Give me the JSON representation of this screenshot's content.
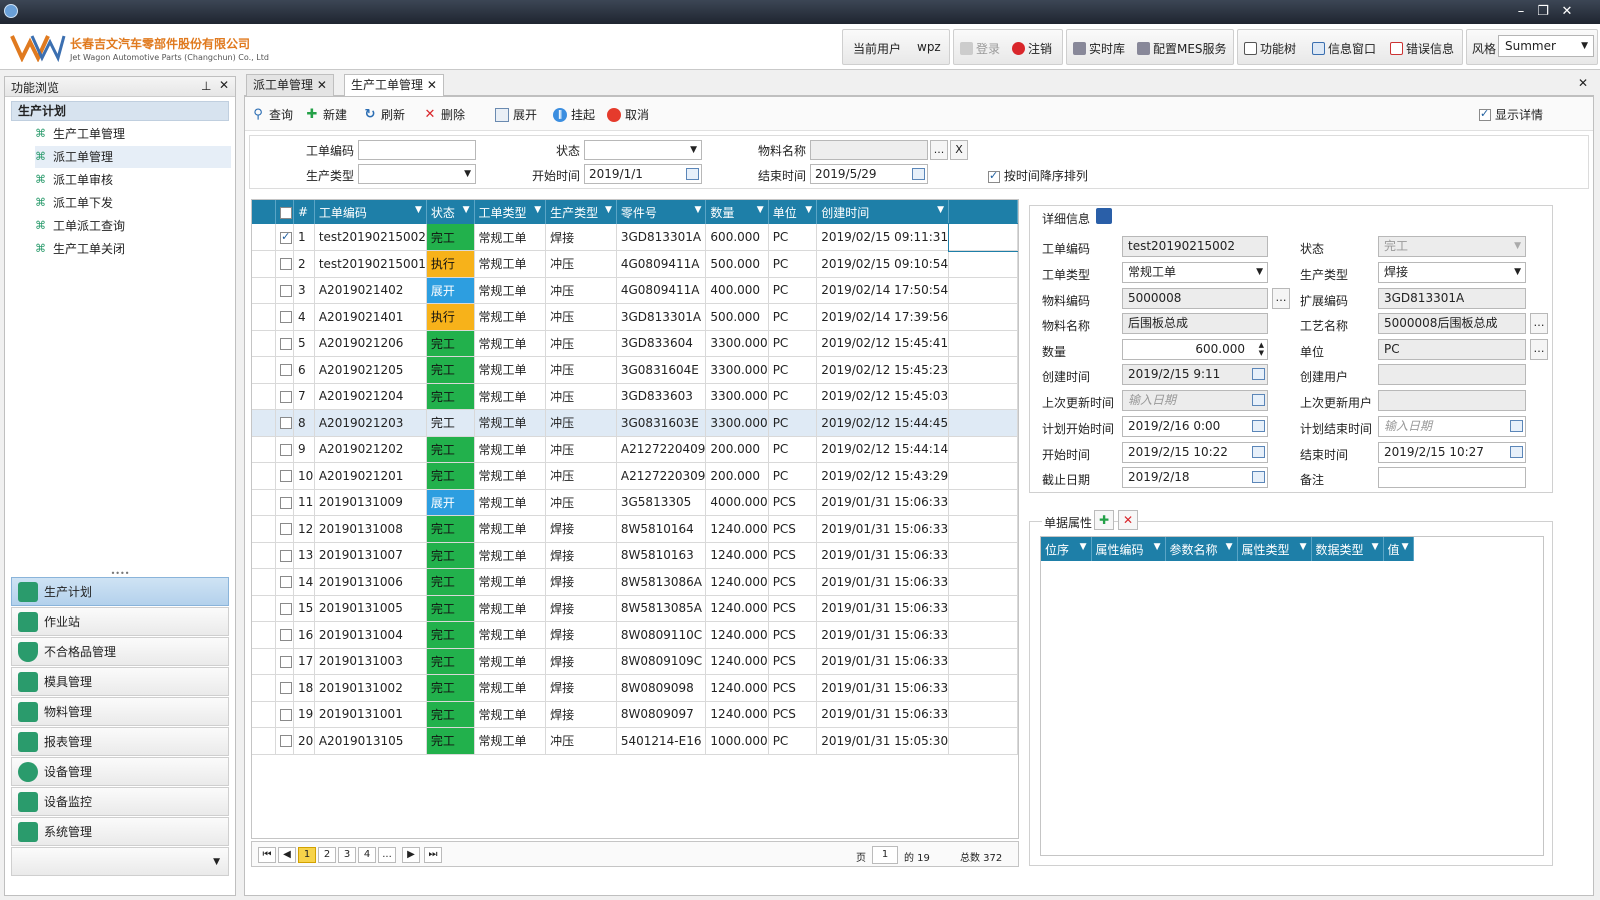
{
  "header": {
    "company_cn": "长春吉文汽车零部件股份有限公司",
    "company_en": "Jet Wagon Automotive Parts (Changchun) Co., Ltd",
    "current_user_label": "当前用户",
    "current_user": "wpz",
    "login": "登录",
    "logout": "注销",
    "realtime_db": "实时库",
    "config_mes": "配置MES服务",
    "func_tree": "功能树",
    "info_window": "信息窗口",
    "error_info": "错误信息",
    "style_label": "风格",
    "style_value": "Summer"
  },
  "left_panel": {
    "title": "功能浏览",
    "section": "生产计划",
    "tree_items": [
      "生产工单管理",
      "派工单管理",
      "派工单审核",
      "派工单下发",
      "工单派工查询",
      "生产工单关闭"
    ],
    "nav_buttons": [
      "生产计划",
      "作业站",
      "不合格品管理",
      "模具管理",
      "物料管理",
      "报表管理",
      "设备管理",
      "设备监控",
      "系统管理"
    ]
  },
  "tabs": [
    "派工单管理",
    "生产工单管理"
  ],
  "toolbar": {
    "query": "查询",
    "new": "新建",
    "refresh": "刷新",
    "delete": "删除",
    "expand": "展开",
    "suspend": "挂起",
    "cancel": "取消",
    "show_detail": "显示详情"
  },
  "filters": {
    "order_no_label": "工单编码",
    "status_label": "状态",
    "material_name_label": "物料名称",
    "prod_type_label": "生产类型",
    "start_time_label": "开始时间",
    "start_time": "2019/1/1",
    "end_time_label": "结束时间",
    "end_time": "2019/5/29",
    "sort_desc_label": "按时间降序排列",
    "clear_btn": "X",
    "more_btn": "..."
  },
  "grid": {
    "columns": [
      "#",
      "工单编码",
      "状态",
      "工单类型",
      "生产类型",
      "零件号",
      "数量",
      "单位",
      "创建时间"
    ],
    "rows": [
      [
        "1",
        "test20190215002",
        "完工",
        "常规工单",
        "焊接",
        "3GD813301A",
        "600.000",
        "PC",
        "2019/02/15 09:11:31"
      ],
      [
        "2",
        "test20190215001",
        "执行",
        "常规工单",
        "冲压",
        "4G0809411A",
        "500.000",
        "PC",
        "2019/02/15 09:10:54"
      ],
      [
        "3",
        "A2019021402",
        "展开",
        "常规工单",
        "冲压",
        "4G0809411A",
        "400.000",
        "PC",
        "2019/02/14 17:50:54"
      ],
      [
        "4",
        "A2019021401",
        "执行",
        "常规工单",
        "冲压",
        "3GD813301A",
        "500.000",
        "PC",
        "2019/02/14 17:39:56"
      ],
      [
        "5",
        "A2019021206",
        "完工",
        "常规工单",
        "冲压",
        "3GD833604",
        "3300.000",
        "PC",
        "2019/02/12 15:45:41"
      ],
      [
        "6",
        "A2019021205",
        "完工",
        "常规工单",
        "冲压",
        "3G0831604E",
        "3300.000",
        "PC",
        "2019/02/12 15:45:23"
      ],
      [
        "7",
        "A2019021204",
        "完工",
        "常规工单",
        "冲压",
        "3GD833603",
        "3300.000",
        "PC",
        "2019/02/12 15:45:03"
      ],
      [
        "8",
        "A2019021203",
        "完工",
        "常规工单",
        "冲压",
        "3G0831603E",
        "3300.000",
        "PC",
        "2019/02/12 15:44:45"
      ],
      [
        "9",
        "A2019021202",
        "完工",
        "常规工单",
        "冲压",
        "A2127220409",
        "200.000",
        "PC",
        "2019/02/12 15:44:14"
      ],
      [
        "10",
        "A2019021201",
        "完工",
        "常规工单",
        "冲压",
        "A2127220309",
        "200.000",
        "PC",
        "2019/02/12 15:43:29"
      ],
      [
        "11",
        "20190131009",
        "展开",
        "常规工单",
        "冲压",
        "3G5813305",
        "4000.000",
        "PCS",
        "2019/01/31 15:06:33"
      ],
      [
        "12",
        "20190131008",
        "完工",
        "常规工单",
        "焊接",
        "8W5810164",
        "1240.000",
        "PCS",
        "2019/01/31 15:06:33"
      ],
      [
        "13",
        "20190131007",
        "完工",
        "常规工单",
        "焊接",
        "8W5810163",
        "1240.000",
        "PCS",
        "2019/01/31 15:06:33"
      ],
      [
        "14",
        "20190131006",
        "完工",
        "常规工单",
        "焊接",
        "8W5813086A",
        "1240.000",
        "PCS",
        "2019/01/31 15:06:33"
      ],
      [
        "15",
        "20190131005",
        "完工",
        "常规工单",
        "焊接",
        "8W5813085A",
        "1240.000",
        "PCS",
        "2019/01/31 15:06:33"
      ],
      [
        "16",
        "20190131004",
        "完工",
        "常规工单",
        "焊接",
        "8W0809110C",
        "1240.000",
        "PCS",
        "2019/01/31 15:06:33"
      ],
      [
        "17",
        "20190131003",
        "完工",
        "常规工单",
        "焊接",
        "8W0809109C",
        "1240.000",
        "PCS",
        "2019/01/31 15:06:33"
      ],
      [
        "18",
        "20190131002",
        "完工",
        "常规工单",
        "焊接",
        "8W0809098",
        "1240.000",
        "PCS",
        "2019/01/31 15:06:33"
      ],
      [
        "19",
        "20190131001",
        "完工",
        "常规工单",
        "焊接",
        "8W0809097",
        "1240.000",
        "PCS",
        "2019/01/31 15:06:33"
      ],
      [
        "20",
        "A2019013105",
        "完工",
        "常规工单",
        "冲压",
        "5401214-E16",
        "1000.000",
        "PC",
        "2019/01/31 15:05:30"
      ]
    ]
  },
  "pager": {
    "pages": [
      "1",
      "2",
      "3",
      "4",
      "..."
    ],
    "page_label": "页",
    "page_value": "1",
    "of_label": "的 19",
    "total_label": "总数 372"
  },
  "detail": {
    "title": "详细信息",
    "order_no_label": "工单编码",
    "order_no": "test20190215002",
    "status_label": "状态",
    "status": "完工",
    "order_type_label": "工单类型",
    "order_type": "常规工单",
    "prod_type_label": "生产类型",
    "prod_type": "焊接",
    "material_code_label": "物料编码",
    "material_code": "5000008",
    "ext_code_label": "扩展编码",
    "ext_code": "3GD813301A",
    "material_name_label": "物料名称",
    "material_name": "后围板总成",
    "process_name_label": "工艺名称",
    "process_name": "5000008后围板总成",
    "qty_label": "数量",
    "qty": "600.000",
    "unit_label": "单位",
    "unit": "PC",
    "created_label": "创建时间",
    "created": "2019/2/15 9:11",
    "creator_label": "创建用户",
    "last_update_label": "上次更新时间",
    "last_update_placeholder": "输入日期",
    "last_user_label": "上次更新用户",
    "plan_start_label": "计划开始时间",
    "plan_start": "2019/2/16 0:00",
    "plan_end_label": "计划结束时间",
    "plan_end_placeholder": "输入日期",
    "start_label": "开始时间",
    "start": "2019/2/15 10:22",
    "end_label": "结束时间",
    "end": "2019/2/15 10:27",
    "deadline_label": "截止日期",
    "deadline": "2019/2/18",
    "remark_label": "备注"
  },
  "props": {
    "title": "单据属性",
    "columns": [
      "位序",
      "属性编码",
      "参数名称",
      "属性类型",
      "数据类型",
      "值"
    ]
  },
  "colors": {
    "grid_header": "#1e7fa8",
    "status_done": "#22b14c",
    "status_exec": "#f7b21a",
    "status_open": "#2d9ee0",
    "brand": "#e07a1f"
  }
}
